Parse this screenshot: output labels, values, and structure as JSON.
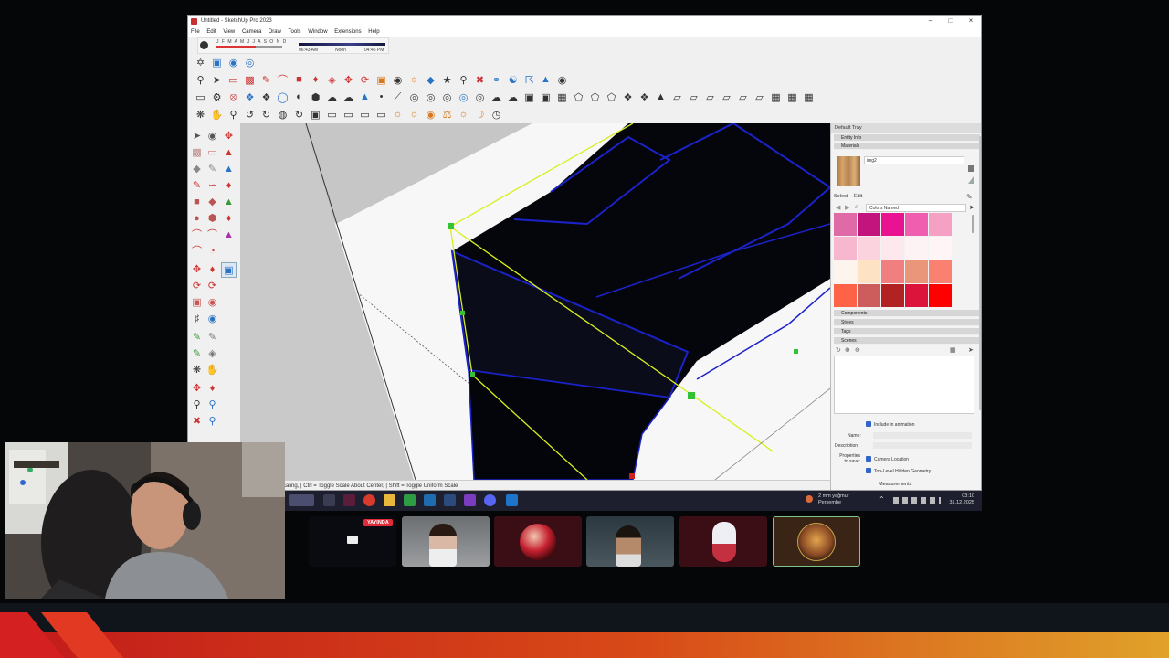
{
  "window": {
    "title": "Untitled - SketchUp Pro 2023",
    "minimize_icon": "minimize-icon",
    "maximize_icon": "maximize-icon",
    "close_icon": "close-icon"
  },
  "menubar": {
    "items": [
      "File",
      "Edit",
      "View",
      "Camera",
      "Draw",
      "Tools",
      "Window",
      "Extensions",
      "Help"
    ]
  },
  "shadow_settings": {
    "months": "J F M A M J J A S O N D",
    "time_start": "06:43 AM",
    "time_mid": "Noon",
    "time_end": "04:45 PM"
  },
  "status_bar": {
    "text": "caling, | Ctrl = Toggle Scale About Center, | Shift = Toggle Uniform Scale"
  },
  "tray": {
    "title": "Default Tray",
    "entity_info_label": "Entity Info",
    "materials_label": "Materials",
    "material_name": "img2",
    "select_tab": "Select",
    "edit_tab": "Edit",
    "collection": "Colors Named",
    "components_label": "Components",
    "styles_label": "Styles",
    "tags_label": "Tags",
    "scenes_label": "Scenes",
    "include_animation": "Include in animation",
    "name_label": "Name:",
    "description_label": "Description:",
    "properties_label": "Properties to save:",
    "camera_location": "Camera Location",
    "hidden_geometry": "Top-Level Hidden Geometry",
    "measurements_label": "Measurements"
  },
  "swatch_colors": [
    "#e06aa6",
    "#c3147d",
    "#e91391",
    "#ef5eaf",
    "#f5a1c3",
    "#f7b8cf",
    "#fbd3de",
    "#fde8ee",
    "#fdf2f4",
    "#fff5f7",
    "#fef4ee",
    "#fde3c4",
    "#f08080",
    "#e9967a",
    "#fa8072",
    "#ff6347",
    "#cd5c5c",
    "#b22222",
    "#dc143c",
    "#ff0000"
  ],
  "taskbar": {
    "weather": "2 mm yağmur",
    "weather_day": "Perşembe",
    "time": "03:10",
    "date": "31.12.2025"
  },
  "discord": {
    "live_badge": "YAYINDA"
  }
}
